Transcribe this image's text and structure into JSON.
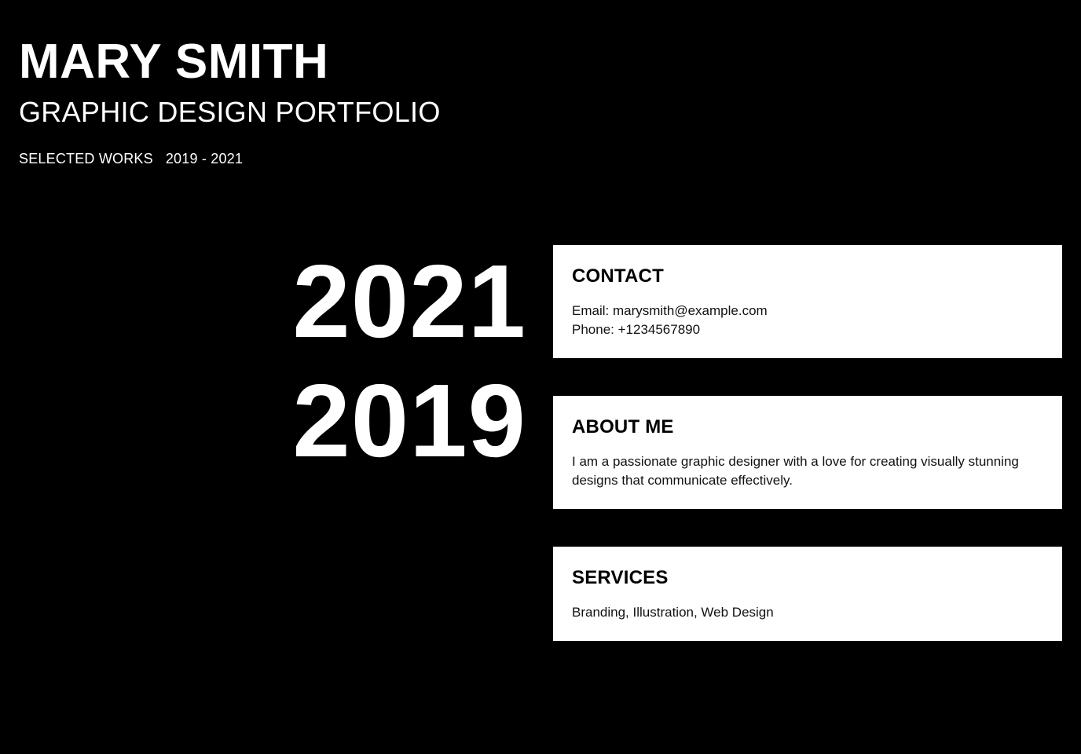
{
  "header": {
    "name": "MARY SMITH",
    "subtitle": "GRAPHIC DESIGN PORTFOLIO",
    "selected_works": "SELECTED WORKS",
    "date_range": "2019 - 2021"
  },
  "years": [
    "2021",
    "2019"
  ],
  "cards": {
    "contact": {
      "title": "CONTACT",
      "email": "Email: marysmith@example.com",
      "phone": "Phone: +1234567890"
    },
    "about": {
      "title": "ABOUT ME",
      "text": "I am a passionate graphic designer with a love for creating visually stunning designs that communicate effectively."
    },
    "services": {
      "title": "SERVICES",
      "text": "Branding, Illustration, Web Design"
    }
  },
  "colors": {
    "background": "#000000",
    "card_background": "#ffffff",
    "primary_text": "#ffffff",
    "card_text": "#000000"
  }
}
